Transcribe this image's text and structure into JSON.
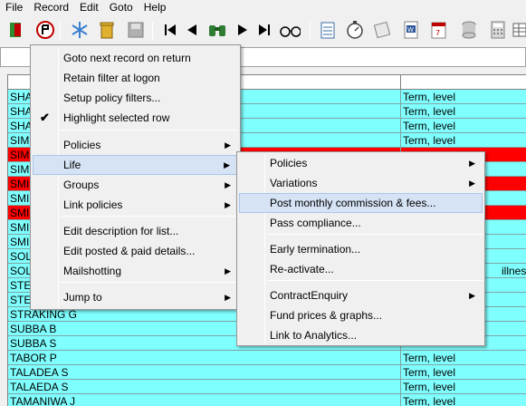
{
  "menubar": [
    "File",
    "Record",
    "Edit",
    "Goto",
    "Help"
  ],
  "toolbar": {
    "icons": [
      "exit-door-icon",
      "stop-filter-icon",
      "snowflake-icon",
      "trash-icon",
      "save-disk-icon",
      "first-record-icon",
      "previous-record-icon",
      "binoculars-icon",
      "next-record-icon",
      "last-record-icon",
      "spectacles-icon",
      "notepad-icon",
      "stopwatch-icon",
      "scroll-icon",
      "word-document-icon",
      "calendar-icon",
      "database-icon",
      "calculator-icon",
      "grid-icon"
    ]
  },
  "grid": {
    "rows": [
      {
        "name": "SHA",
        "note": "Term, level",
        "highlight": false
      },
      {
        "name": "SHA",
        "note": "Term, level",
        "highlight": false
      },
      {
        "name": "SHA",
        "note": "Term, level",
        "highlight": false
      },
      {
        "name": "SIMI",
        "note": "Term, level",
        "highlight": false
      },
      {
        "name": "SIMI",
        "note": "",
        "highlight": true
      },
      {
        "name": "SIMI",
        "note": "",
        "highlight": false
      },
      {
        "name": "SMI",
        "note": "",
        "highlight": true
      },
      {
        "name": "SMI",
        "note": "",
        "highlight": false
      },
      {
        "name": "SMI",
        "note": "",
        "highlight": true
      },
      {
        "name": "SMI",
        "note": "",
        "highlight": false
      },
      {
        "name": "SMI",
        "note": "",
        "highlight": false
      },
      {
        "name": "SOL",
        "note": "",
        "highlight": false
      },
      {
        "name": "SOL",
        "note": "illness",
        "highlight": false
      },
      {
        "name": "STE",
        "note": "",
        "highlight": false
      },
      {
        "name": "STE",
        "note": "",
        "highlight": false
      },
      {
        "name": "STRAKING G",
        "note": "",
        "highlight": false
      },
      {
        "name": "SUBBA B",
        "note": "",
        "highlight": false
      },
      {
        "name": "SUBBA S",
        "note": "",
        "highlight": false
      },
      {
        "name": "TABOR P",
        "note": "Term, level",
        "highlight": false
      },
      {
        "name": "TALADEA S",
        "note": "Term, level",
        "highlight": false
      },
      {
        "name": "TALAEDA S",
        "note": "Term, level",
        "highlight": false
      },
      {
        "name": "TAMANIWA J",
        "note": "Term, level",
        "highlight": false
      }
    ]
  },
  "context_menu": {
    "items": [
      {
        "label": "Goto next record on return",
        "submenu": false,
        "checked": false
      },
      {
        "label": "Retain filter at logon",
        "submenu": false,
        "checked": false
      },
      {
        "label": "Setup policy filters...",
        "submenu": false,
        "checked": false
      },
      {
        "label": "Highlight selected row",
        "submenu": false,
        "checked": true
      },
      {
        "label": "Policies",
        "submenu": true,
        "checked": false
      },
      {
        "label": "Life",
        "submenu": true,
        "checked": false,
        "active": true
      },
      {
        "label": "Groups",
        "submenu": true,
        "checked": false
      },
      {
        "label": "Link policies",
        "submenu": true,
        "checked": false
      },
      {
        "label": "Edit description for list...",
        "submenu": false,
        "checked": false
      },
      {
        "label": "Edit posted & paid details...",
        "submenu": false,
        "checked": false
      },
      {
        "label": "Mailshotting",
        "submenu": true,
        "checked": false
      },
      {
        "label": "Jump to",
        "submenu": true,
        "checked": false
      }
    ]
  },
  "life_submenu": {
    "items": [
      {
        "label": "Policies",
        "submenu": true
      },
      {
        "label": "Variations",
        "submenu": true
      },
      {
        "label": "Post monthly commission & fees...",
        "submenu": false,
        "active": true
      },
      {
        "label": "Pass compliance...",
        "submenu": false
      },
      {
        "label": "Early termination...",
        "submenu": false
      },
      {
        "label": "Re-activate...",
        "submenu": false
      },
      {
        "label": "ContractEnquiry",
        "submenu": true
      },
      {
        "label": "Fund prices & graphs...",
        "submenu": false
      },
      {
        "label": "Link to Analytics...",
        "submenu": false
      }
    ]
  },
  "colors": {
    "row_bg": "#80ffff",
    "row_red": "#ff0000",
    "menu_highlight": "#d5e3f4"
  }
}
